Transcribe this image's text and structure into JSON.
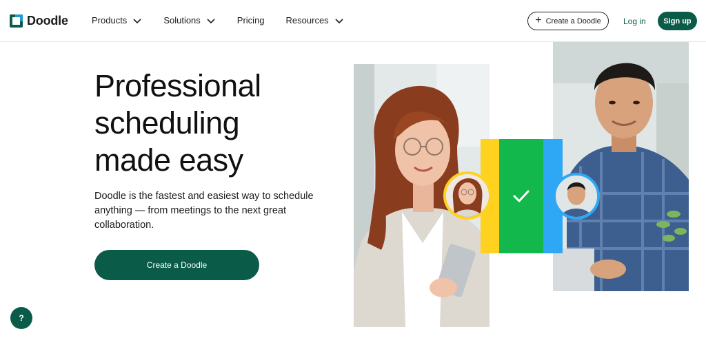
{
  "brand": {
    "name": "Doodle"
  },
  "nav": {
    "items": [
      {
        "label": "Products",
        "has_dropdown": true
      },
      {
        "label": "Solutions",
        "has_dropdown": true
      },
      {
        "label": "Pricing",
        "has_dropdown": false
      },
      {
        "label": "Resources",
        "has_dropdown": true
      }
    ],
    "create_label": "Create a Doodle",
    "login_label": "Log in",
    "signup_label": "Sign up"
  },
  "hero": {
    "title": "Professional scheduling made easy",
    "subtitle": "Doodle is the fastest and easiest way to schedule anything — from meetings to the next great collaboration.",
    "cta_label": "Create a Doodle"
  },
  "help": {
    "label": "?"
  },
  "icons": {
    "logo": "doodle-logo-icon",
    "chevron": "chevron-down-icon",
    "plus": "plus-icon",
    "check": "checkmark-icon"
  },
  "colors": {
    "brand_green": "#0a5c48",
    "bar_yellow": "#ffd21f",
    "bar_green": "#13b84c",
    "bar_blue": "#2ea8f5",
    "logo_blue": "#1e9bd7"
  }
}
